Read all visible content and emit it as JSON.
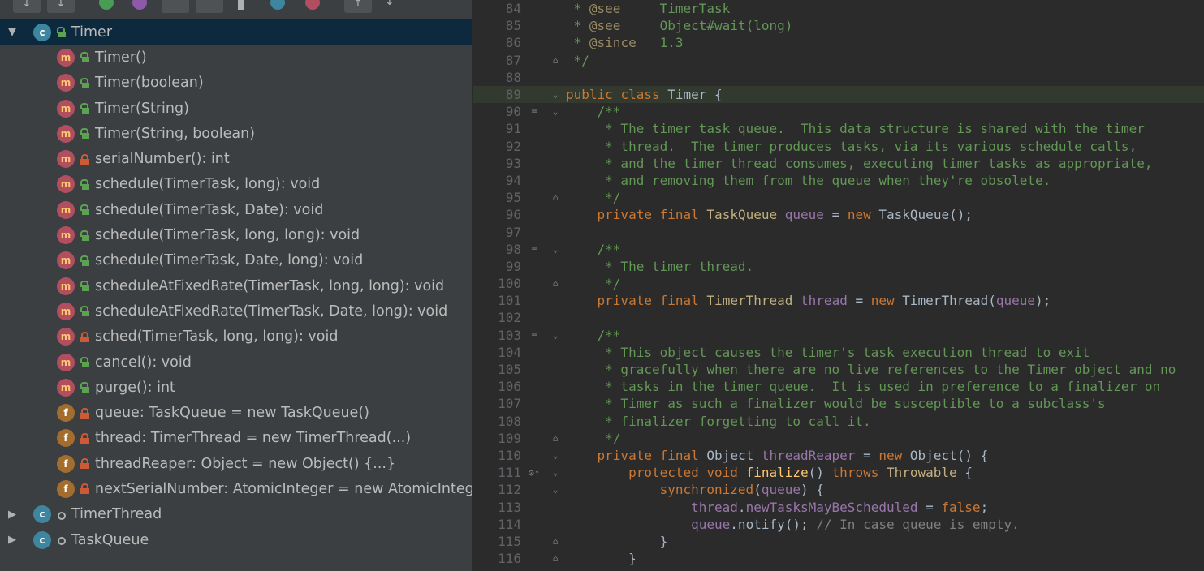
{
  "structure": {
    "items": [
      {
        "label": "Timer",
        "type": "class",
        "access": "public",
        "expanded": true
      },
      {
        "label": "Timer()",
        "type": "method",
        "access": "public"
      },
      {
        "label": "Timer(boolean)",
        "type": "method",
        "access": "public"
      },
      {
        "label": "Timer(String)",
        "type": "method",
        "access": "public"
      },
      {
        "label": "Timer(String, boolean)",
        "type": "method",
        "access": "public"
      },
      {
        "label": "serialNumber(): int",
        "type": "method",
        "access": "private"
      },
      {
        "label": "schedule(TimerTask, long): void",
        "type": "method",
        "access": "public"
      },
      {
        "label": "schedule(TimerTask, Date): void",
        "type": "method",
        "access": "public"
      },
      {
        "label": "schedule(TimerTask, long, long): void",
        "type": "method",
        "access": "public"
      },
      {
        "label": "schedule(TimerTask, Date, long): void",
        "type": "method",
        "access": "public"
      },
      {
        "label": "scheduleAtFixedRate(TimerTask, long, long): void",
        "type": "method",
        "access": "public"
      },
      {
        "label": "scheduleAtFixedRate(TimerTask, Date, long): void",
        "type": "method",
        "access": "public"
      },
      {
        "label": "sched(TimerTask, long, long): void",
        "type": "method",
        "access": "private"
      },
      {
        "label": "cancel(): void",
        "type": "method",
        "access": "public"
      },
      {
        "label": "purge(): int",
        "type": "method",
        "access": "public"
      },
      {
        "label": "queue: TaskQueue = new TaskQueue()",
        "type": "field",
        "access": "private"
      },
      {
        "label": "thread: TimerThread = new TimerThread(...)",
        "type": "field",
        "access": "private"
      },
      {
        "label": "threadReaper: Object = new Object() {...}",
        "type": "field",
        "access": "private"
      },
      {
        "label": "nextSerialNumber: AtomicInteger = new AtomicInteger(",
        "type": "field",
        "access": "private"
      },
      {
        "label": "TimerThread",
        "type": "class",
        "access": "package",
        "expanded": false
      },
      {
        "label": "TaskQueue",
        "type": "class",
        "access": "package",
        "expanded": false
      }
    ]
  },
  "editor": {
    "lines": [
      {
        "n": "84",
        "text": " * @see     TimerTask"
      },
      {
        "n": "85",
        "text": " * @see     Object#wait(long)"
      },
      {
        "n": "86",
        "text": " * @since   1.3"
      },
      {
        "n": "87",
        "text": " */"
      },
      {
        "n": "88",
        "text": ""
      },
      {
        "n": "89",
        "text": "public class Timer {"
      },
      {
        "n": "90",
        "text": "    /**"
      },
      {
        "n": "91",
        "text": "     * The timer task queue.  This data structure is shared with the timer"
      },
      {
        "n": "92",
        "text": "     * thread.  The timer produces tasks, via its various schedule calls,"
      },
      {
        "n": "93",
        "text": "     * and the timer thread consumes, executing timer tasks as appropriate,"
      },
      {
        "n": "94",
        "text": "     * and removing them from the queue when they're obsolete."
      },
      {
        "n": "95",
        "text": "     */"
      },
      {
        "n": "96",
        "text": "    private final TaskQueue queue = new TaskQueue();"
      },
      {
        "n": "97",
        "text": ""
      },
      {
        "n": "98",
        "text": "    /**"
      },
      {
        "n": "99",
        "text": "     * The timer thread."
      },
      {
        "n": "100",
        "text": "     */"
      },
      {
        "n": "101",
        "text": "    private final TimerThread thread = new TimerThread(queue);"
      },
      {
        "n": "102",
        "text": ""
      },
      {
        "n": "103",
        "text": "    /**"
      },
      {
        "n": "104",
        "text": "     * This object causes the timer's task execution thread to exit"
      },
      {
        "n": "105",
        "text": "     * gracefully when there are no live references to the Timer object and no"
      },
      {
        "n": "106",
        "text": "     * tasks in the timer queue.  It is used in preference to a finalizer on"
      },
      {
        "n": "107",
        "text": "     * Timer as such a finalizer would be susceptible to a subclass's"
      },
      {
        "n": "108",
        "text": "     * finalizer forgetting to call it."
      },
      {
        "n": "109",
        "text": "     */"
      },
      {
        "n": "110",
        "text": "    private final Object threadReaper = new Object() {"
      },
      {
        "n": "111",
        "text": "        protected void finalize() throws Throwable {"
      },
      {
        "n": "112",
        "text": "            synchronized(queue) {"
      },
      {
        "n": "113",
        "text": "                thread.newTasksMayBeScheduled = false;"
      },
      {
        "n": "114",
        "text": "                queue.notify(); // In case queue is empty."
      },
      {
        "n": "115",
        "text": "            }"
      },
      {
        "n": "116",
        "text": "        }"
      }
    ],
    "highlighted_line": "89"
  }
}
